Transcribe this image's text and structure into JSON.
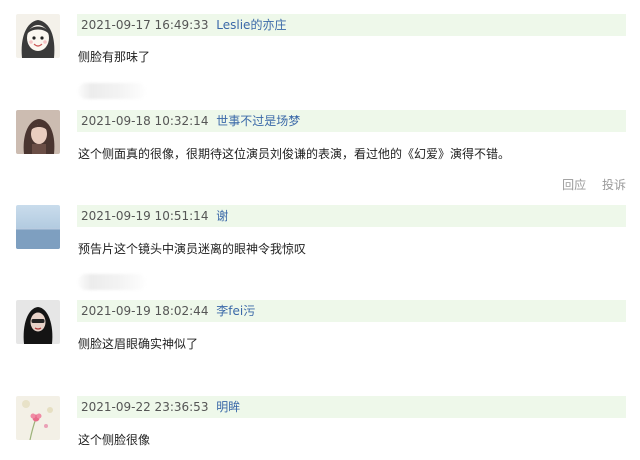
{
  "comments": [
    {
      "timestamp": "2021-09-17 16:49:33",
      "username": "Leslie的亦庄",
      "text": "侧脸有那味了",
      "avatar": "cartoon-face-avatar"
    },
    {
      "timestamp": "2021-09-18 10:32:14",
      "username": "世事不过是场梦",
      "text": "这个侧面真的很像，很期待这位演员刘俊谦的表演，看过他的《幻爱》演得不错。",
      "avatar": "woman-portrait-avatar",
      "actions": {
        "reply": "回应",
        "report": "投诉"
      }
    },
    {
      "timestamp": "2021-09-19 10:51:14",
      "username": "谢",
      "text": "预告片这个镜头中演员迷离的眼神令我惊叹",
      "avatar": "sea-landscape-avatar"
    },
    {
      "timestamp": "2021-09-19 18:02:44",
      "username": "李fei污",
      "text": "侧脸这眉眼确实神似了",
      "avatar": "dark-portrait-avatar"
    },
    {
      "timestamp": "2021-09-22 23:36:53",
      "username": "明眸",
      "text": "这个侧脸很像",
      "avatar": "flower-avatar"
    }
  ],
  "colors": {
    "meta_background": "#eef8ea",
    "username": "#3a68a8",
    "action_text": "#999999"
  }
}
